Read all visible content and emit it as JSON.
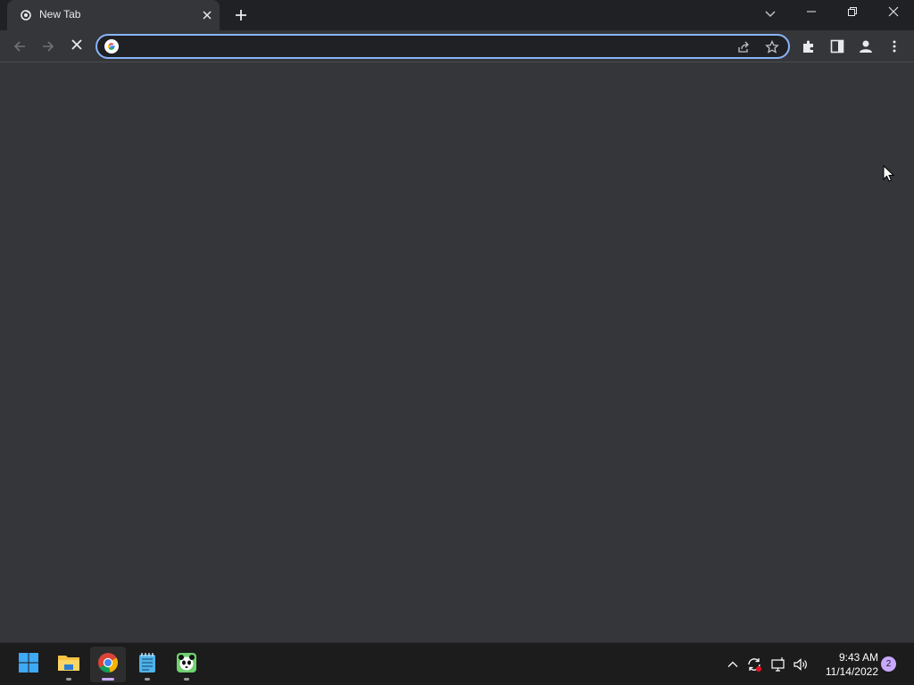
{
  "browser": {
    "tab": {
      "title": "New Tab",
      "favicon": "chrome-newtab-icon"
    },
    "tab_controls": {
      "new_tab_icon": "plus-icon",
      "tab_search_icon": "chevron-down-icon"
    },
    "window_controls": [
      "minimize-icon",
      "restore-icon",
      "close-icon"
    ],
    "toolbar": {
      "back_icon": "arrow-left-icon",
      "forward_icon": "arrow-right-icon",
      "stop_icon": "close-icon",
      "omnibox": {
        "value": "",
        "placeholder": "",
        "leading_icon": "google-icon",
        "trailing_icons": [
          "share-icon",
          "star-icon"
        ]
      },
      "right_icons": [
        "extensions-icon",
        "side-panel-icon",
        "profile-icon",
        "kebab-menu-icon"
      ]
    }
  },
  "taskbar": {
    "apps": [
      {
        "name": "Start",
        "icon": "windows-logo-icon"
      },
      {
        "name": "File Explorer",
        "icon": "folder-icon"
      },
      {
        "name": "Google Chrome",
        "icon": "chrome-icon",
        "active": true
      },
      {
        "name": "Notepad",
        "icon": "notepad-icon"
      },
      {
        "name": "App",
        "icon": "panda-icon"
      }
    ],
    "tray": {
      "icons": [
        "chevron-up-icon",
        "sync-icon",
        "network-icon",
        "volume-icon"
      ],
      "time": "9:43 AM",
      "date": "11/14/2022",
      "notification_count": "2"
    }
  },
  "colors": {
    "frame": "#202124",
    "toolbar": "#35363a",
    "omnibox_border": "#8ab4f8",
    "taskbar": "#1c1c1c",
    "accent": "#c9a7ff"
  }
}
